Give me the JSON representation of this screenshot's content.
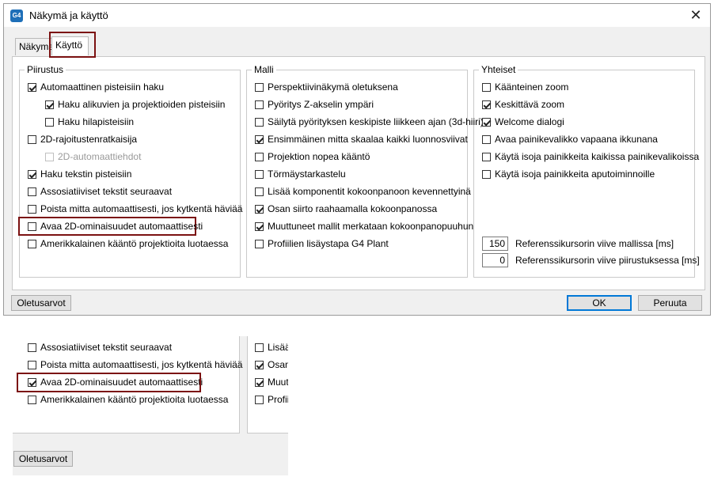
{
  "window": {
    "title": "Näkymä ja käyttö",
    "icon_text": "G4"
  },
  "tabs": [
    {
      "label": "Näkymä"
    },
    {
      "label": "Käyttö"
    }
  ],
  "groups": {
    "piirustus": {
      "legend": "Piirustus",
      "items": [
        {
          "label": "Automaattinen pisteisiin haku",
          "checked": true
        },
        {
          "label": "Haku alikuvien ja projektioiden pisteisiin",
          "checked": true
        },
        {
          "label": "Haku hilapisteisiin",
          "checked": false
        },
        {
          "label": "2D-rajoitustenratkaisija",
          "checked": false
        },
        {
          "label": "2D-automaattiehdot",
          "checked": false,
          "disabled": true
        },
        {
          "label": "Haku tekstin pisteisiin",
          "checked": true
        },
        {
          "label": "Assosiatiiviset tekstit seuraavat",
          "checked": false
        },
        {
          "label": "Poista mitta automaattisesti, jos kytkentä häviää",
          "checked": false
        },
        {
          "label": "Avaa 2D-ominaisuudet automaattisesti",
          "checked": false
        },
        {
          "label": "Amerikkalainen kääntö projektioita luotaessa",
          "checked": false
        }
      ]
    },
    "malli": {
      "legend": "Malli",
      "items": [
        {
          "label": "Perspektiivinäkymä oletuksena",
          "checked": false
        },
        {
          "label": "Pyöritys Z-akselin ympäri",
          "checked": false
        },
        {
          "label": "Säilytä pyörityksen keskipiste liikkeen ajan (3d-hiiri)",
          "checked": false
        },
        {
          "label": "Ensimmäinen mitta skaalaa kaikki luonnosviivat",
          "checked": true
        },
        {
          "label": "Projektion nopea kääntö",
          "checked": false
        },
        {
          "label": "Törmäystarkastelu",
          "checked": false
        },
        {
          "label": "Lisää komponentit kokoonpanoon kevennettyinä",
          "checked": false
        },
        {
          "label": "Osan siirto raahaamalla kokoonpanossa",
          "checked": true
        },
        {
          "label": "Muuttuneet mallit merkataan kokoonpanopuuhun",
          "checked": true
        },
        {
          "label": "Profiilien lisäystapa G4 Plant",
          "checked": false
        }
      ]
    },
    "yhteiset": {
      "legend": "Yhteiset",
      "items": [
        {
          "label": "Käänteinen zoom",
          "checked": false
        },
        {
          "label": "Keskittävä zoom",
          "checked": true
        },
        {
          "label": "Welcome dialogi",
          "checked": true
        },
        {
          "label": "Avaa painikevalikko vapaana ikkunana",
          "checked": false
        },
        {
          "label": "Käytä isoja painikkeita kaikissa painikevalikoissa",
          "checked": false
        },
        {
          "label": "Käytä isoja painikkeita aputoiminnoille",
          "checked": false
        }
      ],
      "fields": [
        {
          "value": "150",
          "label": "Referenssikursorin viive mallissa [ms]"
        },
        {
          "value": "0",
          "label": "Referenssikursorin viive piirustuksessa [ms]"
        }
      ]
    }
  },
  "buttons": {
    "defaults": "Oletusarvot",
    "ok": "OK",
    "cancel": "Peruuta"
  },
  "zoom_inset": {
    "left_items": [
      {
        "label": "Assosiatiiviset tekstit seuraavat",
        "checked": false
      },
      {
        "label": "Poista mitta automaattisesti, jos kytkentä häviää",
        "checked": false
      },
      {
        "label": "Avaa 2D-ominaisuudet automaattisesti",
        "checked": true
      },
      {
        "label": "Amerikkalainen kääntö projektioita luotaessa",
        "checked": false
      }
    ],
    "right_items": [
      {
        "label": "Lisää",
        "checked": false
      },
      {
        "label": "Osan",
        "checked": true
      },
      {
        "label": "Muutt",
        "checked": true
      },
      {
        "label": "Profiil",
        "checked": false
      }
    ],
    "defaults_button": "Oletusarvot"
  },
  "colors": {
    "highlight": "#7b1111",
    "primary_border": "#0078d7",
    "dialog_bg": "#f0f0f0"
  }
}
